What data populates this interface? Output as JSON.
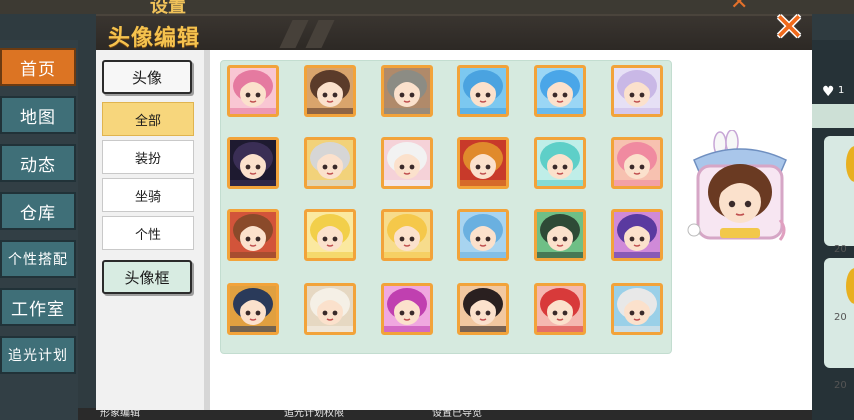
{
  "background": {
    "title": "设置",
    "left_nav": [
      "首页",
      "地图",
      "动态",
      "仓库",
      "个性搭配",
      "工作室",
      "追光计划"
    ],
    "active_index": 0,
    "heart_count": "1",
    "card_labels": [
      "20",
      "20",
      "20",
      "2"
    ],
    "bottom_tabs": [
      "形象编辑",
      "追光计划权限",
      "设置已导览"
    ]
  },
  "dialog": {
    "title": "头像编辑",
    "close_icon": "close-icon",
    "categories": {
      "avatar": "头像",
      "frame": "头像框"
    },
    "subcategories": [
      {
        "label": "全部",
        "active": true
      },
      {
        "label": "装扮",
        "active": false
      },
      {
        "label": "坐骑",
        "active": false
      },
      {
        "label": "个性",
        "active": false
      }
    ],
    "avatars": [
      {
        "icon": "pink-hair-girl-avatar",
        "hair": "#e57aa0",
        "bg": "#f9c6d3"
      },
      {
        "icon": "brown-hair-boy-avatar",
        "hair": "#5b3b2a",
        "bg": "#d9a46c"
      },
      {
        "icon": "gray-warrior-avatar",
        "hair": "#8c8c84",
        "bg": "#b08a6a"
      },
      {
        "icon": "blue-cat-avatar",
        "hair": "#4aa3e0",
        "bg": "#7cc8f0"
      },
      {
        "icon": "snowman-avatar",
        "hair": "#4aa6e8",
        "bg": "#9ad6f5"
      },
      {
        "icon": "lavender-girl-avatar",
        "hair": "#c9b8e6",
        "bg": "#e6e0f5"
      },
      {
        "icon": "shadow-cat-avatar",
        "hair": "#3a2e55",
        "bg": "#1e1a30"
      },
      {
        "icon": "silver-fox-avatar",
        "hair": "#d6d6d6",
        "bg": "#f2d27a"
      },
      {
        "icon": "white-bunny-avatar",
        "hair": "#f2f2f2",
        "bg": "#f5d2d8"
      },
      {
        "icon": "red-fox-girl-avatar",
        "hair": "#e08a2c",
        "bg": "#c83a2a"
      },
      {
        "icon": "teal-twin-girl-avatar",
        "hair": "#5ecfc8",
        "bg": "#bfeee8"
      },
      {
        "icon": "pink-witch-avatar",
        "hair": "#f08aa0",
        "bg": "#f7c1b0"
      },
      {
        "icon": "brown-cat-boy-avatar",
        "hair": "#8a4a2a",
        "bg": "#d2543a"
      },
      {
        "icon": "blonde-girl-avatar",
        "hair": "#f2cf4a",
        "bg": "#fbe9a0"
      },
      {
        "icon": "golden-princess-avatar",
        "hair": "#f5c84a",
        "bg": "#f7dc8c"
      },
      {
        "icon": "mech-pilot-avatar",
        "hair": "#6ab0e0",
        "bg": "#a8d4f0"
      },
      {
        "icon": "green-hair-girl-avatar",
        "hair": "#2e4a36",
        "bg": "#6fbf86"
      },
      {
        "icon": "purple-pony-avatar",
        "hair": "#5a3aa0",
        "bg": "#d08ad8"
      },
      {
        "icon": "clockwork-fox-avatar",
        "hair": "#2a3a5a",
        "bg": "#e0a040"
      },
      {
        "icon": "bear-hood-boy-avatar",
        "hair": "#f5f0e6",
        "bg": "#e6d8c2"
      },
      {
        "icon": "magenta-idol-avatar",
        "hair": "#c040b0",
        "bg": "#f0a8e0"
      },
      {
        "icon": "dark-bun-girl-avatar",
        "hair": "#2a2020",
        "bg": "#f2c8a0"
      },
      {
        "icon": "red-hood-girl-avatar",
        "hair": "#d83a3a",
        "bg": "#f5b8b0"
      },
      {
        "icon": "polar-bear-boy-avatar",
        "hair": "#e8e8e8",
        "bg": "#9ad0e8"
      }
    ],
    "preview": {
      "icon": "bunny-frame-girl-preview",
      "hair": "#6a3a22",
      "frame": "#a9c6ea"
    }
  }
}
